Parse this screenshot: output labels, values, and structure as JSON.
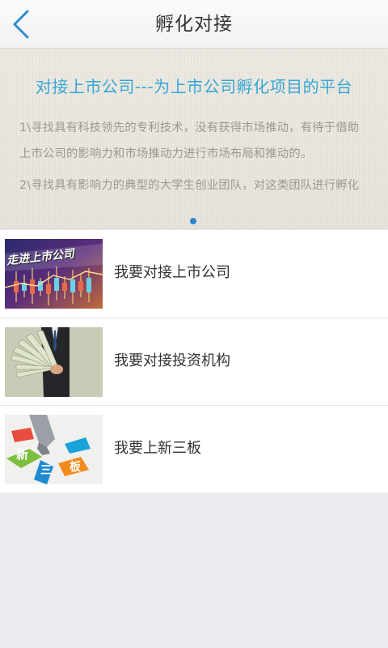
{
  "header": {
    "title": "孵化对接"
  },
  "banner": {
    "headline": "对接上市公司---为上市公司孵化项目的平台",
    "paragraph_1_line_1": "1\\寻找具有科技领先的专利技术，没有获得市场推动，有待于借助",
    "paragraph_1_line_2": "上市公司的影响力和市场推动力进行市场布局和推动的。",
    "paragraph_2_line_1": "2\\寻找具有影响力的典型的大学生创业团队，对这类团队进行孵化"
  },
  "list": {
    "items": [
      {
        "label": "我要对接上市公司",
        "thumb_text": "走进上市公司"
      },
      {
        "label": "我要对接投资机构"
      },
      {
        "label": "我要上新三板",
        "thumb_text_1": "新",
        "thumb_text_2": "三",
        "thumb_text_3": "板"
      }
    ]
  },
  "colors": {
    "accent": "#35a7d4",
    "indicator": "#2b86cf",
    "background": "#e9ebee"
  }
}
